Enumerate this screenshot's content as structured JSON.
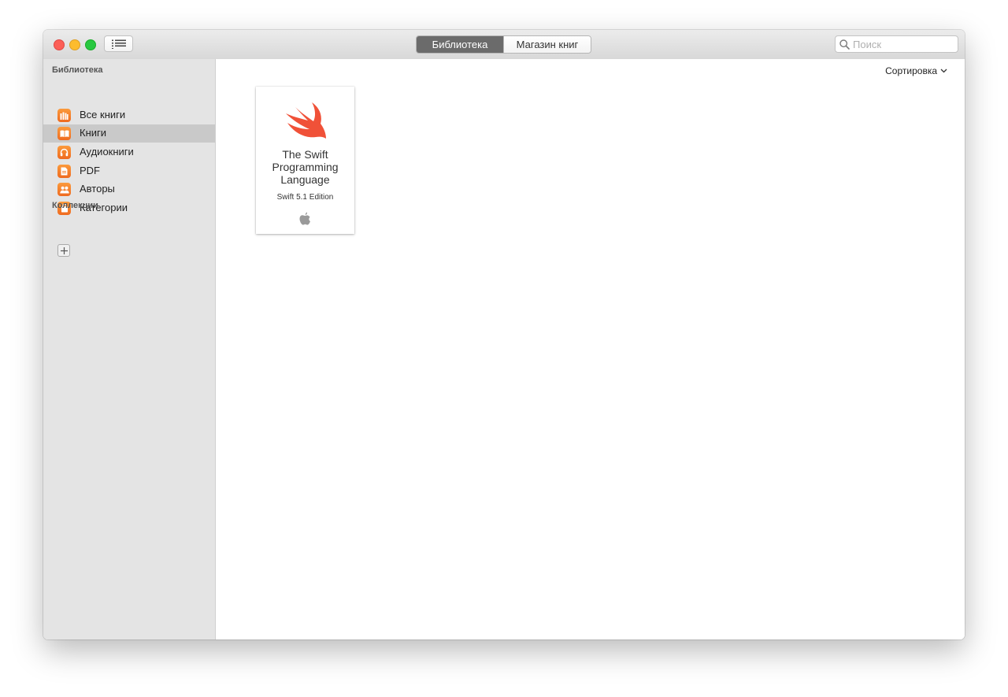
{
  "toolbar": {
    "tabs": [
      {
        "label": "Библиотека",
        "active": true
      },
      {
        "label": "Магазин книг",
        "active": false
      }
    ],
    "search_placeholder": "Поиск",
    "sidebar_toggle_icon": "list-icon"
  },
  "sidebar": {
    "library_title": "Библиотека",
    "items": [
      {
        "label": "Все книги",
        "icon": "library-icon",
        "selected": false
      },
      {
        "label": "Книги",
        "icon": "open-book-icon",
        "selected": true
      },
      {
        "label": "Аудиокниги",
        "icon": "headphones-icon",
        "selected": false
      },
      {
        "label": "PDF",
        "icon": "document-icon",
        "selected": false
      },
      {
        "label": "Авторы",
        "icon": "people-icon",
        "selected": false
      },
      {
        "label": "Категории",
        "icon": "shopping-bag-icon",
        "selected": false
      }
    ],
    "collections_title": "Коллекции",
    "add_icon": "plus-icon"
  },
  "main": {
    "sort_label": "Сортировка",
    "books": [
      {
        "title": "The Swift Programming Language",
        "edition": "Swift 5.1 Edition",
        "cover_icon": "swift-bird-icon",
        "publisher_icon": "apple-logo-icon"
      }
    ]
  },
  "colors": {
    "accent_orange": "#f07a2a",
    "swift_red": "#f05138",
    "selected_tab": "#6b6b6b",
    "sidebar_bg": "#e4e4e4",
    "selected_row": "#c9c9c9"
  }
}
